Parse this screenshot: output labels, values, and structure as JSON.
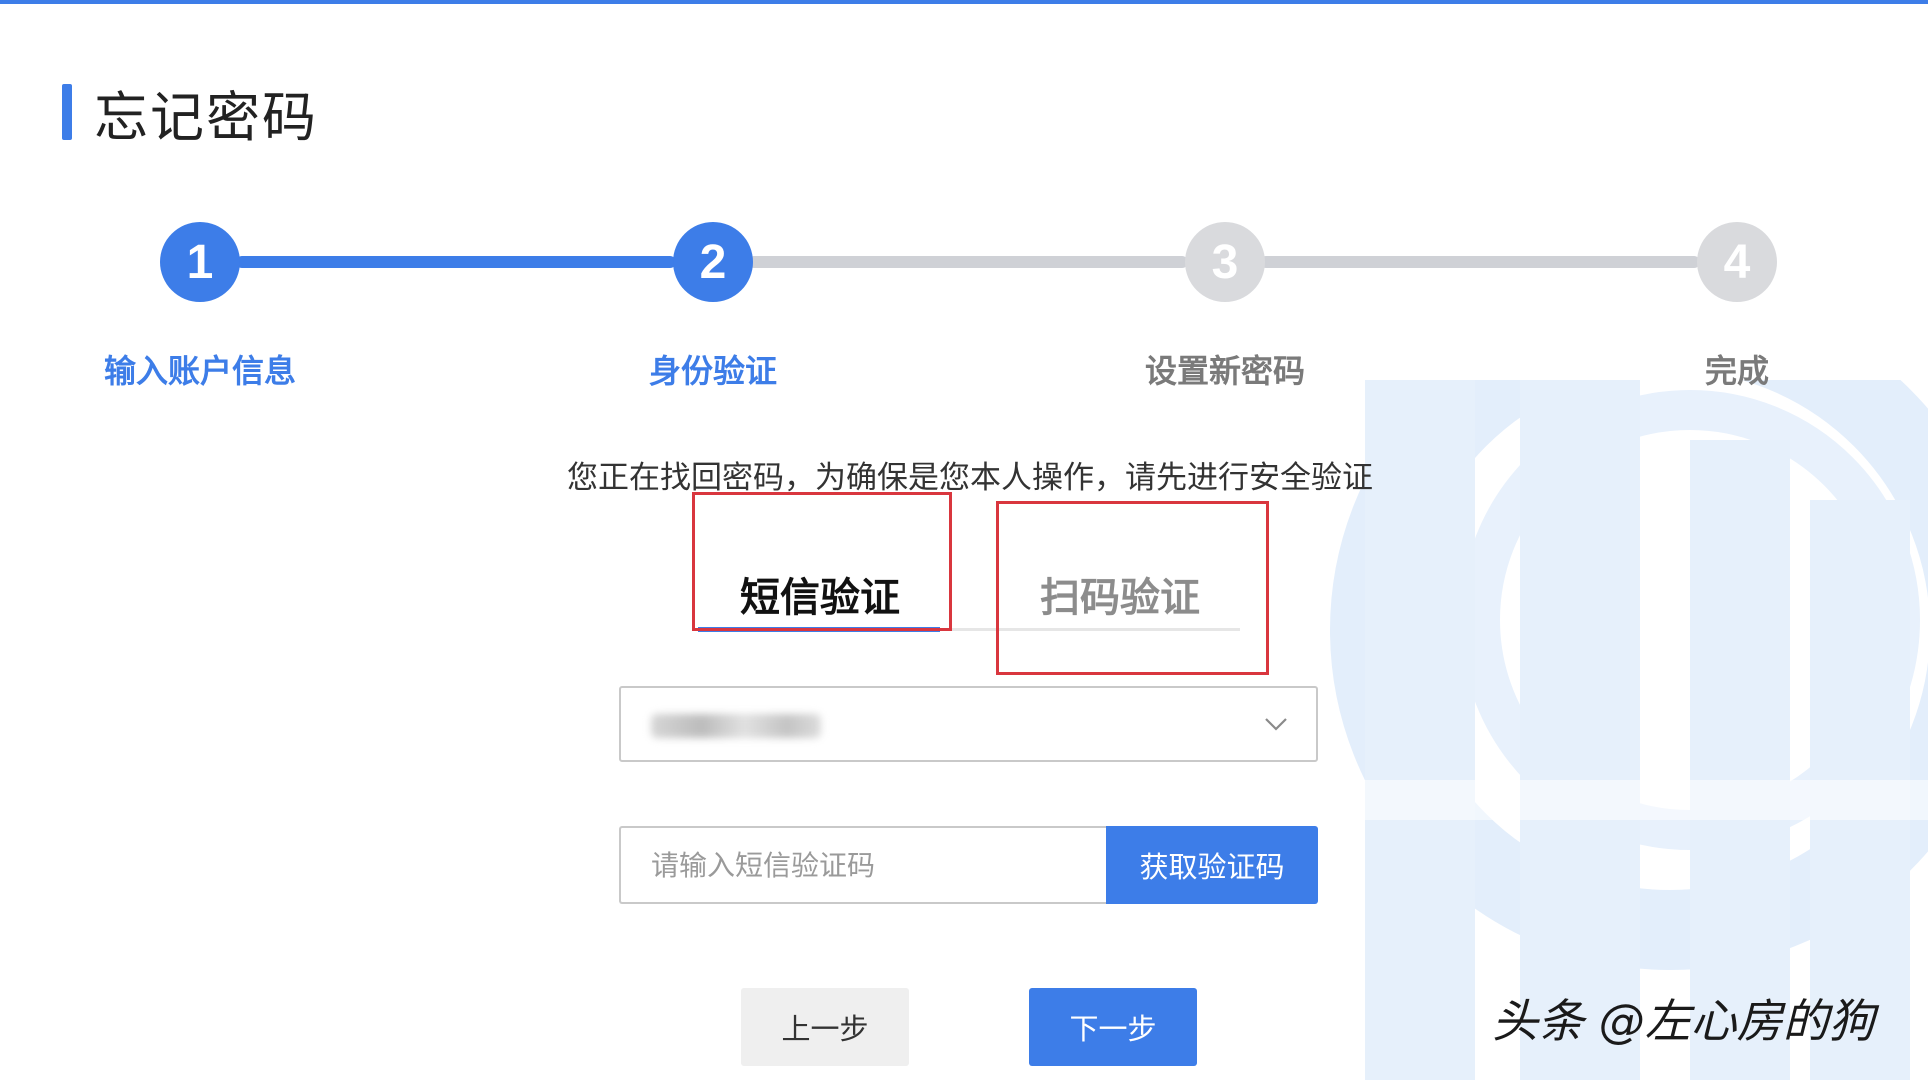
{
  "page": {
    "title": "忘记密码"
  },
  "steps": [
    {
      "number": "1",
      "label": "输入账户信息",
      "state": "done"
    },
    {
      "number": "2",
      "label": "身份验证",
      "state": "current"
    },
    {
      "number": "3",
      "label": "设置新密码",
      "state": "todo"
    },
    {
      "number": "4",
      "label": "完成",
      "state": "todo"
    }
  ],
  "intro_text": "您正在找回密码，为确保是您本人操作，请先进行安全验证",
  "tabs": [
    {
      "label": "短信验证",
      "active": true
    },
    {
      "label": "扫码验证",
      "active": false
    }
  ],
  "phone_select": {
    "icon": "chevron-down-icon"
  },
  "code_input": {
    "placeholder": "请输入短信验证码",
    "value": ""
  },
  "get_code_label": "获取验证码",
  "buttons": {
    "prev": "上一步",
    "next": "下一步"
  },
  "watermark": "头条 @左心房的狗",
  "colors": {
    "accent": "#3d7de8",
    "inactive": "#d9dadd",
    "highlight": "#d9363e"
  }
}
